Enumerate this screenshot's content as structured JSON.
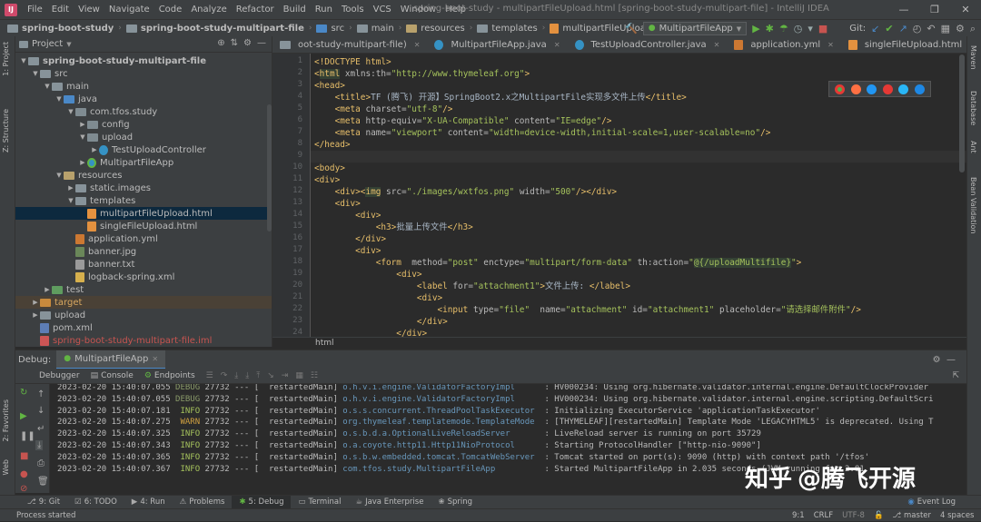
{
  "menubar": {
    "items": [
      "File",
      "Edit",
      "View",
      "Navigate",
      "Code",
      "Analyze",
      "Refactor",
      "Build",
      "Run",
      "Tools",
      "VCS",
      "Window",
      "Help"
    ],
    "window_title": "spring-boot-study - multipartFileUpload.html [spring-boot-study-multipart-file] - IntelliJ IDEA"
  },
  "navbar": {
    "crumbs": [
      "spring-boot-study",
      "spring-boot-study-multipart-file",
      "src",
      "main",
      "resources",
      "templates",
      "multipartFileUpload.html"
    ],
    "run_config": "MultipartFileApp",
    "git_label": "Git:"
  },
  "left_strip": {
    "project": "1: Project",
    "structure": "Z: Structure",
    "favorites": "2: Favorites",
    "web": "Web"
  },
  "right_strip": {
    "maven": "Maven",
    "database": "Database",
    "ant": "Ant",
    "bean": "Bean Validation"
  },
  "project": {
    "title": "Project",
    "tree": [
      {
        "label": "spring-boot-study-multipart-file",
        "depth": 1,
        "icon": "folder",
        "arrow": "▼",
        "bold": true
      },
      {
        "label": "src",
        "depth": 2,
        "icon": "folder",
        "arrow": "▼"
      },
      {
        "label": "main",
        "depth": 3,
        "icon": "folder",
        "arrow": "▼"
      },
      {
        "label": "java",
        "depth": 4,
        "icon": "src",
        "arrow": "▼"
      },
      {
        "label": "com.tfos.study",
        "depth": 5,
        "icon": "pkg",
        "arrow": "▼"
      },
      {
        "label": "config",
        "depth": 6,
        "icon": "pkg",
        "arrow": "▶"
      },
      {
        "label": "upload",
        "depth": 6,
        "icon": "pkg",
        "arrow": "▼"
      },
      {
        "label": "TestUploadController",
        "depth": 7,
        "icon": "cls",
        "arrow": "▶"
      },
      {
        "label": "MultipartFileApp",
        "depth": 6,
        "icon": "app",
        "arrow": "▶"
      },
      {
        "label": "resources",
        "depth": 4,
        "icon": "res",
        "arrow": "▼"
      },
      {
        "label": "static.images",
        "depth": 5,
        "icon": "folder",
        "arrow": "▶"
      },
      {
        "label": "templates",
        "depth": 5,
        "icon": "folder",
        "arrow": "▼"
      },
      {
        "label": "multipartFileUpload.html",
        "depth": 6,
        "icon": "html",
        "arrow": "",
        "selected": true
      },
      {
        "label": "singleFileUpload.html",
        "depth": 6,
        "icon": "html",
        "arrow": ""
      },
      {
        "label": "application.yml",
        "depth": 5,
        "icon": "yml",
        "arrow": ""
      },
      {
        "label": "banner.jpg",
        "depth": 5,
        "icon": "img",
        "arrow": ""
      },
      {
        "label": "banner.txt",
        "depth": 5,
        "icon": "txt",
        "arrow": ""
      },
      {
        "label": "logback-spring.xml",
        "depth": 5,
        "icon": "xml",
        "arrow": ""
      },
      {
        "label": "test",
        "depth": 3,
        "icon": "tst",
        "arrow": "▶"
      },
      {
        "label": "target",
        "depth": 2,
        "icon": "tgt",
        "arrow": "▶",
        "highlight": true
      },
      {
        "label": "upload",
        "depth": 2,
        "icon": "folder",
        "arrow": "▶"
      },
      {
        "label": "pom.xml",
        "depth": 2,
        "icon": "pom",
        "arrow": ""
      },
      {
        "label": "spring-boot-study-multipart-file.iml",
        "depth": 2,
        "icon": "iml",
        "arrow": "",
        "red": true
      }
    ]
  },
  "editor": {
    "tabs": [
      {
        "label": "oot-study-multipart-file)",
        "active": false
      },
      {
        "label": "MultipartFileApp.java",
        "active": false
      },
      {
        "label": "TestUploadController.java",
        "active": false
      },
      {
        "label": "application.yml",
        "active": false
      },
      {
        "label": "singleFileUpload.html",
        "active": false
      },
      {
        "label": "multipartFileUpload.html",
        "active": true
      }
    ],
    "lines": [
      {
        "n": "1",
        "html": "&lt;!DOCTYPE html&gt;"
      },
      {
        "n": "2",
        "html": "&lt;<span class='mhl'>html</span> <span class='a'>xmlns:th=</span><span class='v'>\"http://www.thymeleaf.org\"</span>&gt;"
      },
      {
        "n": "3",
        "html": "&lt;head&gt;"
      },
      {
        "n": "4",
        "html": "    &lt;title&gt;<span class='tx'>TF (腾飞) 开源】SpringBoot2.x之MultipartFile实现多文件上传</span>&lt;/title&gt;"
      },
      {
        "n": "5",
        "html": "    &lt;meta <span class='a'>charset=</span><span class='v'>\"utf-8\"</span>/&gt;"
      },
      {
        "n": "6",
        "html": "    &lt;meta <span class='a'>http-equiv=</span><span class='v'>\"X-UA-Compatible\"</span> <span class='a'>content=</span><span class='v'>\"IE=edge\"</span>/&gt;"
      },
      {
        "n": "7",
        "html": "    &lt;meta <span class='a'>name=</span><span class='v'>\"viewport\"</span> <span class='a'>content=</span><span class='v'>\"width=device-width,initial-scale=1,user-scalable=no\"</span>/&gt;"
      },
      {
        "n": "8",
        "html": "&lt;/head&gt;"
      },
      {
        "n": "9",
        "html": ""
      },
      {
        "n": "10",
        "html": "&lt;body&gt;"
      },
      {
        "n": "11",
        "html": "&lt;div&gt;"
      },
      {
        "n": "12",
        "html": "    &lt;div&gt;&lt;<span class='mhl'>img</span> <span class='a'>src=</span><span class='v'>\"./images/wxtfos.png\"</span> <span class='a'>width=</span><span class='v'>\"500\"</span>/&gt;&lt;/div&gt;"
      },
      {
        "n": "13",
        "html": "    &lt;div&gt;"
      },
      {
        "n": "14",
        "html": "        &lt;div&gt;"
      },
      {
        "n": "15",
        "html": "            &lt;h3&gt;<span class='tx'>批量上传文件</span>&lt;/h3&gt;"
      },
      {
        "n": "16",
        "html": "        &lt;/div&gt;"
      },
      {
        "n": "17",
        "html": "        &lt;div&gt;"
      },
      {
        "n": "18",
        "html": "            &lt;form  <span class='a'>method=</span><span class='v'>\"post\"</span> <span class='a'>enctype=</span><span class='v'>\"multipart/form-data\"</span> <span class='a'>th:action=</span><span class='v'>\"<span class='mhl'>@{/uploadMultifile}</span>\"</span>&gt;"
      },
      {
        "n": "19",
        "html": "                &lt;div&gt;"
      },
      {
        "n": "20",
        "html": "                    &lt;label <span class='a'>for=</span><span class='v'>\"attachment1\"</span>&gt;<span class='tx'>文件上传: </span>&lt;/label&gt;"
      },
      {
        "n": "21",
        "html": "                    &lt;div&gt;"
      },
      {
        "n": "22",
        "html": "                        &lt;input <span class='a'>type=</span><span class='v'>\"file\"</span>  <span class='a'>name=</span><span class='v'>\"attachment\"</span> <span class='a'>id=</span><span class='v'>\"attachment1\"</span> <span class='a'>placeholder=</span><span class='v'>\"请选择邮件附件\"</span>/&gt;"
      },
      {
        "n": "23",
        "html": "                    &lt;/div&gt;"
      },
      {
        "n": "24",
        "html": "                &lt;/div&gt;"
      },
      {
        "n": "25",
        "html": "                &lt;div&gt;"
      }
    ],
    "breadcrumb": "html"
  },
  "debug": {
    "label": "Debug:",
    "config": "MultipartFileApp",
    "tabs": [
      "Debugger",
      "Console",
      "Endpoints"
    ],
    "log": [
      {
        "date": "2023-02-20 15:40:07.055",
        "level": "DEBUG",
        "pid": "27732",
        "thread": "restartedMain",
        "logger": "o.h.v.i.engine.ValidatorFactoryImpl",
        "msg": "HV000234: Using org.hibernate.validator.internal.engine.DefaultClockProvider"
      },
      {
        "date": "2023-02-20 15:40:07.055",
        "level": "DEBUG",
        "pid": "27732",
        "thread": "restartedMain",
        "logger": "o.h.v.i.engine.ValidatorFactoryImpl",
        "msg": "HV000234: Using org.hibernate.validator.internal.engine.scripting.DefaultScri"
      },
      {
        "date": "2023-02-20 15:40:07.181",
        "level": "INFO",
        "pid": "27732",
        "thread": "restartedMain",
        "logger": "o.s.s.concurrent.ThreadPoolTaskExecutor",
        "msg": "Initializing ExecutorService 'applicationTaskExecutor'"
      },
      {
        "date": "2023-02-20 15:40:07.275",
        "level": "WARN",
        "pid": "27732",
        "thread": "restartedMain",
        "logger": "org.thymeleaf.templatemode.TemplateMode",
        "msg": "[THYMELEAF][restartedMain] Template Mode 'LEGACYHTML5' is deprecated. Using T"
      },
      {
        "date": "2023-02-20 15:40:07.325",
        "level": "INFO",
        "pid": "27732",
        "thread": "restartedMain",
        "logger": "o.s.b.d.a.OptionalLiveReloadServer",
        "msg": "LiveReload server is running on port 35729"
      },
      {
        "date": "2023-02-20 15:40:07.343",
        "level": "INFO",
        "pid": "27732",
        "thread": "restartedMain",
        "logger": "o.a.coyote.http11.Http11NioProtocol",
        "msg": "Starting ProtocolHandler [\"http-nio-9090\"]"
      },
      {
        "date": "2023-02-20 15:40:07.365",
        "level": "INFO",
        "pid": "27732",
        "thread": "restartedMain",
        "logger": "o.s.b.w.embedded.tomcat.TomcatWebServer",
        "msg": "Tomcat started on port(s): 9090 (http) with context path '/tfos'"
      },
      {
        "date": "2023-02-20 15:40:07.367",
        "level": "INFO",
        "pid": "27732",
        "thread": "restartedMain",
        "logger": "com.tfos.study.MultipartFileApp",
        "msg": "Started MultipartFileApp in 2.035 seconds (JVM running for 2.81"
      }
    ]
  },
  "bottombar": {
    "tabs": [
      "9: Git",
      "6: TODO",
      "4: Run",
      "Problems",
      "5: Debug",
      "Terminal",
      "Java Enterprise",
      "Spring"
    ],
    "event_log": "Event Log"
  },
  "status": {
    "left": "Process started",
    "position": "9:1",
    "line_sep": "CRLF",
    "encoding": "UTF-8",
    "branch": "master",
    "indent": "4 spaces"
  },
  "watermark": {
    "brand": "知乎",
    "author": "@腾飞开源"
  }
}
